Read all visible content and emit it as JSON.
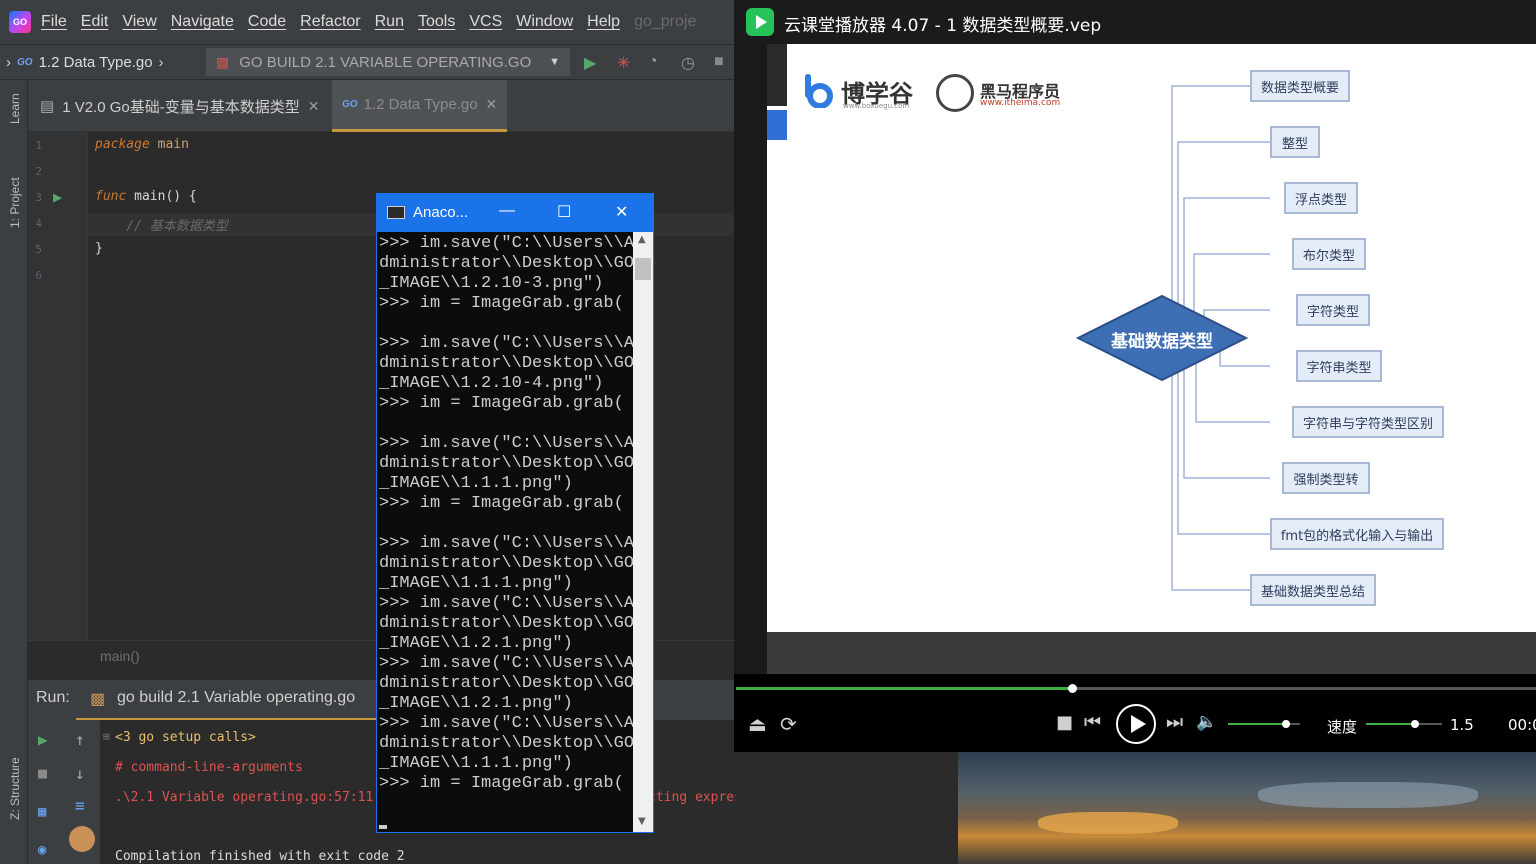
{
  "ide": {
    "menu": [
      "File",
      "Edit",
      "View",
      "Navigate",
      "Code",
      "Refactor",
      "Run",
      "Tools",
      "VCS",
      "Window",
      "Help"
    ],
    "project_hint": "go_proje",
    "breadcrumb": "1.2 Data Type.go",
    "run_config": "GO BUILD 2.1 VARIABLE OPERATING.GO",
    "tabs": [
      {
        "label": "1 V2.0 Go基础-变量与基本数据类型"
      },
      {
        "label": "1.2 Data Type.go"
      }
    ],
    "side_labels": {
      "learn": "Learn",
      "project": "1: Project",
      "structure": "Z: Structure"
    },
    "lines": [
      "1",
      "2",
      "3",
      "4",
      "5",
      "6"
    ],
    "code": {
      "l1_kw": "package",
      "l1_rest": " main",
      "l3_kw": "func",
      "l3_rest": " main() {",
      "l4": "    // 基本数据类型",
      "l5": "}"
    },
    "code_breadcrumb": "main()",
    "run": {
      "label": "Run:",
      "tab": "go build 2.1 Variable operating.go",
      "output": [
        "<3 go setup calls>",
        "# command-line-arguments",
        ".\\2.1 Variable operating.go:57:11",
        "cting expression",
        "Compilation finished with exit code 2"
      ]
    }
  },
  "console": {
    "title": "Anaco...",
    "text": ">>> im.save(\"C:\\\\Users\\\\A\ndministrator\\\\Desktop\\\\GO\n_IMAGE\\\\1.2.10-3.png\")\n>>> im = ImageGrab.grab(\n\n>>> im.save(\"C:\\\\Users\\\\A\ndministrator\\\\Desktop\\\\GO\n_IMAGE\\\\1.2.10-4.png\")\n>>> im = ImageGrab.grab(\n\n>>> im.save(\"C:\\\\Users\\\\A\ndministrator\\\\Desktop\\\\GO\n_IMAGE\\\\1.1.1.png\")\n>>> im = ImageGrab.grab(\n\n>>> im.save(\"C:\\\\Users\\\\A\ndministrator\\\\Desktop\\\\GO\n_IMAGE\\\\1.1.1.png\")\n>>> im.save(\"C:\\\\Users\\\\A\ndministrator\\\\Desktop\\\\GO\n_IMAGE\\\\1.2.1.png\")\n>>> im.save(\"C:\\\\Users\\\\A\ndministrator\\\\Desktop\\\\GO\n_IMAGE\\\\1.2.1.png\")\n>>> im.save(\"C:\\\\Users\\\\A\ndministrator\\\\Desktop\\\\GO\n_IMAGE\\\\1.1.1.png\")\n>>> im = ImageGrab.grab("
  },
  "player": {
    "title": "云课堂播放器 4.07 - 1 数据类型概要.vep",
    "brand1_name": "博学谷",
    "brand1_url": "www.boxuegu.com",
    "brand2_name": "黑马程序员",
    "brand2_url": "www.itheima.com",
    "mindmap": {
      "center": "基础数据类型",
      "nodes": [
        "数据类型概要",
        "整型",
        "浮点类型",
        "布尔类型",
        "字符类型",
        "字符串类型",
        "字符串与字符类型区别",
        "强制类型转",
        "fmt包的格式化输入与输出",
        "基础数据类型总结"
      ]
    },
    "progress": 0.42,
    "volume": 0.8,
    "speed_label": "速度",
    "speed_value": "1.5",
    "speed_level": 0.65,
    "time": "00:0",
    "accent": "#3cb043"
  }
}
